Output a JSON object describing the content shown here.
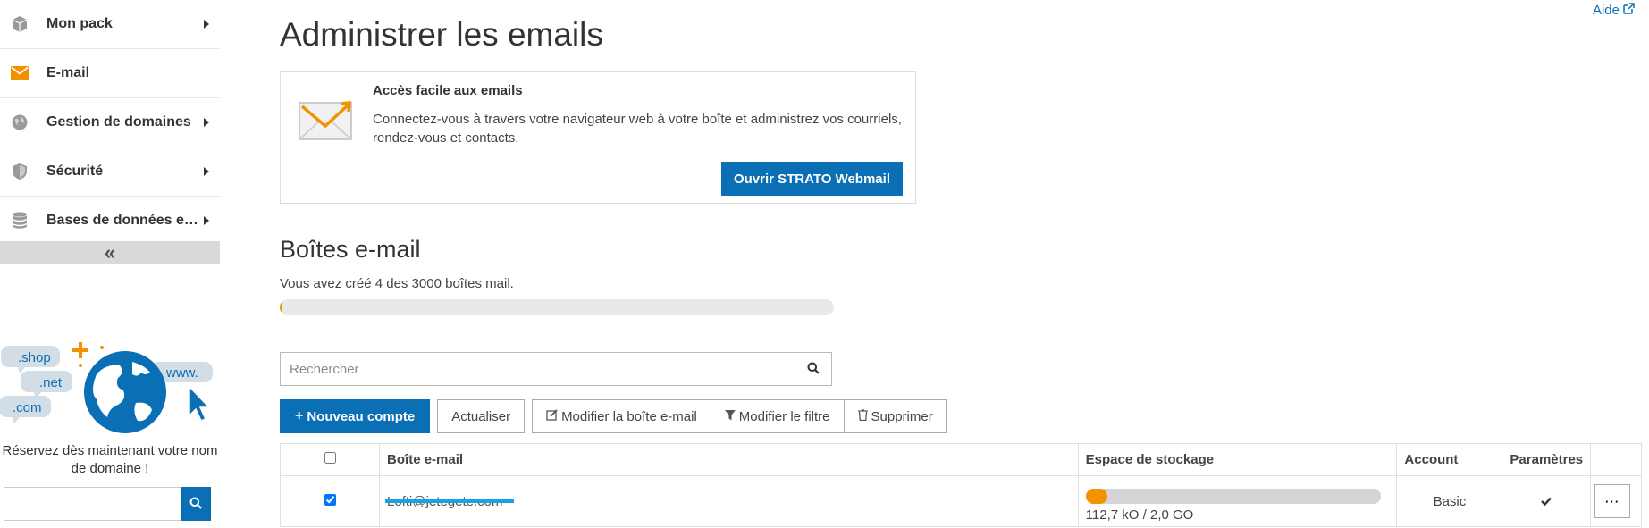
{
  "sidebar": {
    "items": [
      {
        "label": "Mon pack",
        "icon": "box-icon",
        "has_submenu": true
      },
      {
        "label": "E-mail",
        "icon": "envelope-icon",
        "has_submenu": false
      },
      {
        "label": "Gestion de domaines",
        "icon": "globe-icon",
        "has_submenu": true
      },
      {
        "label": "Sécurité",
        "icon": "shield-icon",
        "has_submenu": true
      },
      {
        "label": "Bases de données et e...",
        "icon": "database-icon",
        "has_submenu": true
      }
    ],
    "collapse_label": "«"
  },
  "promo": {
    "bubbles": [
      ".shop",
      ".net",
      ".com",
      "www."
    ],
    "text": "Réservez dès maintenant votre nom de domaine !",
    "search_value": ""
  },
  "header": {
    "help_label": "Aide",
    "title": "Administrer les emails"
  },
  "webmail_card": {
    "title": "Accès facile aux emails",
    "description": "Connectez-vous à travers votre navigateur web à votre boîte et administrez vos courriels, rendez-vous et contacts.",
    "button_label": "Ouvrir STRATO Webmail"
  },
  "mailboxes": {
    "title": "Boîtes e-mail",
    "quota_text": "Vous avez créé 4 des 3000 boîtes mail.",
    "quota_used": 4,
    "quota_total": 3000,
    "search_placeholder": "Rechercher",
    "toolbar": {
      "new_account": "Nouveau compte",
      "refresh": "Actualiser",
      "edit_mailbox": "Modifier la boîte e-mail",
      "edit_filter": "Modifier le filtre",
      "delete": "Supprimer"
    },
    "columns": {
      "mailbox": "Boîte e-mail",
      "storage": "Espace de stockage",
      "account": "Account",
      "settings": "Paramètres"
    },
    "rows": [
      {
        "checked": true,
        "email": "Lofti@jetegete.com",
        "storage_text": "112,7 kO / 2,0 GO",
        "storage_fraction": 0.0001,
        "account": "Basic",
        "settings_icon": "check-icon",
        "more_label": "···"
      }
    ]
  },
  "colors": {
    "accent": "#0a6fb4",
    "orange": "#f39200",
    "redaction": "#1aa1e6"
  }
}
